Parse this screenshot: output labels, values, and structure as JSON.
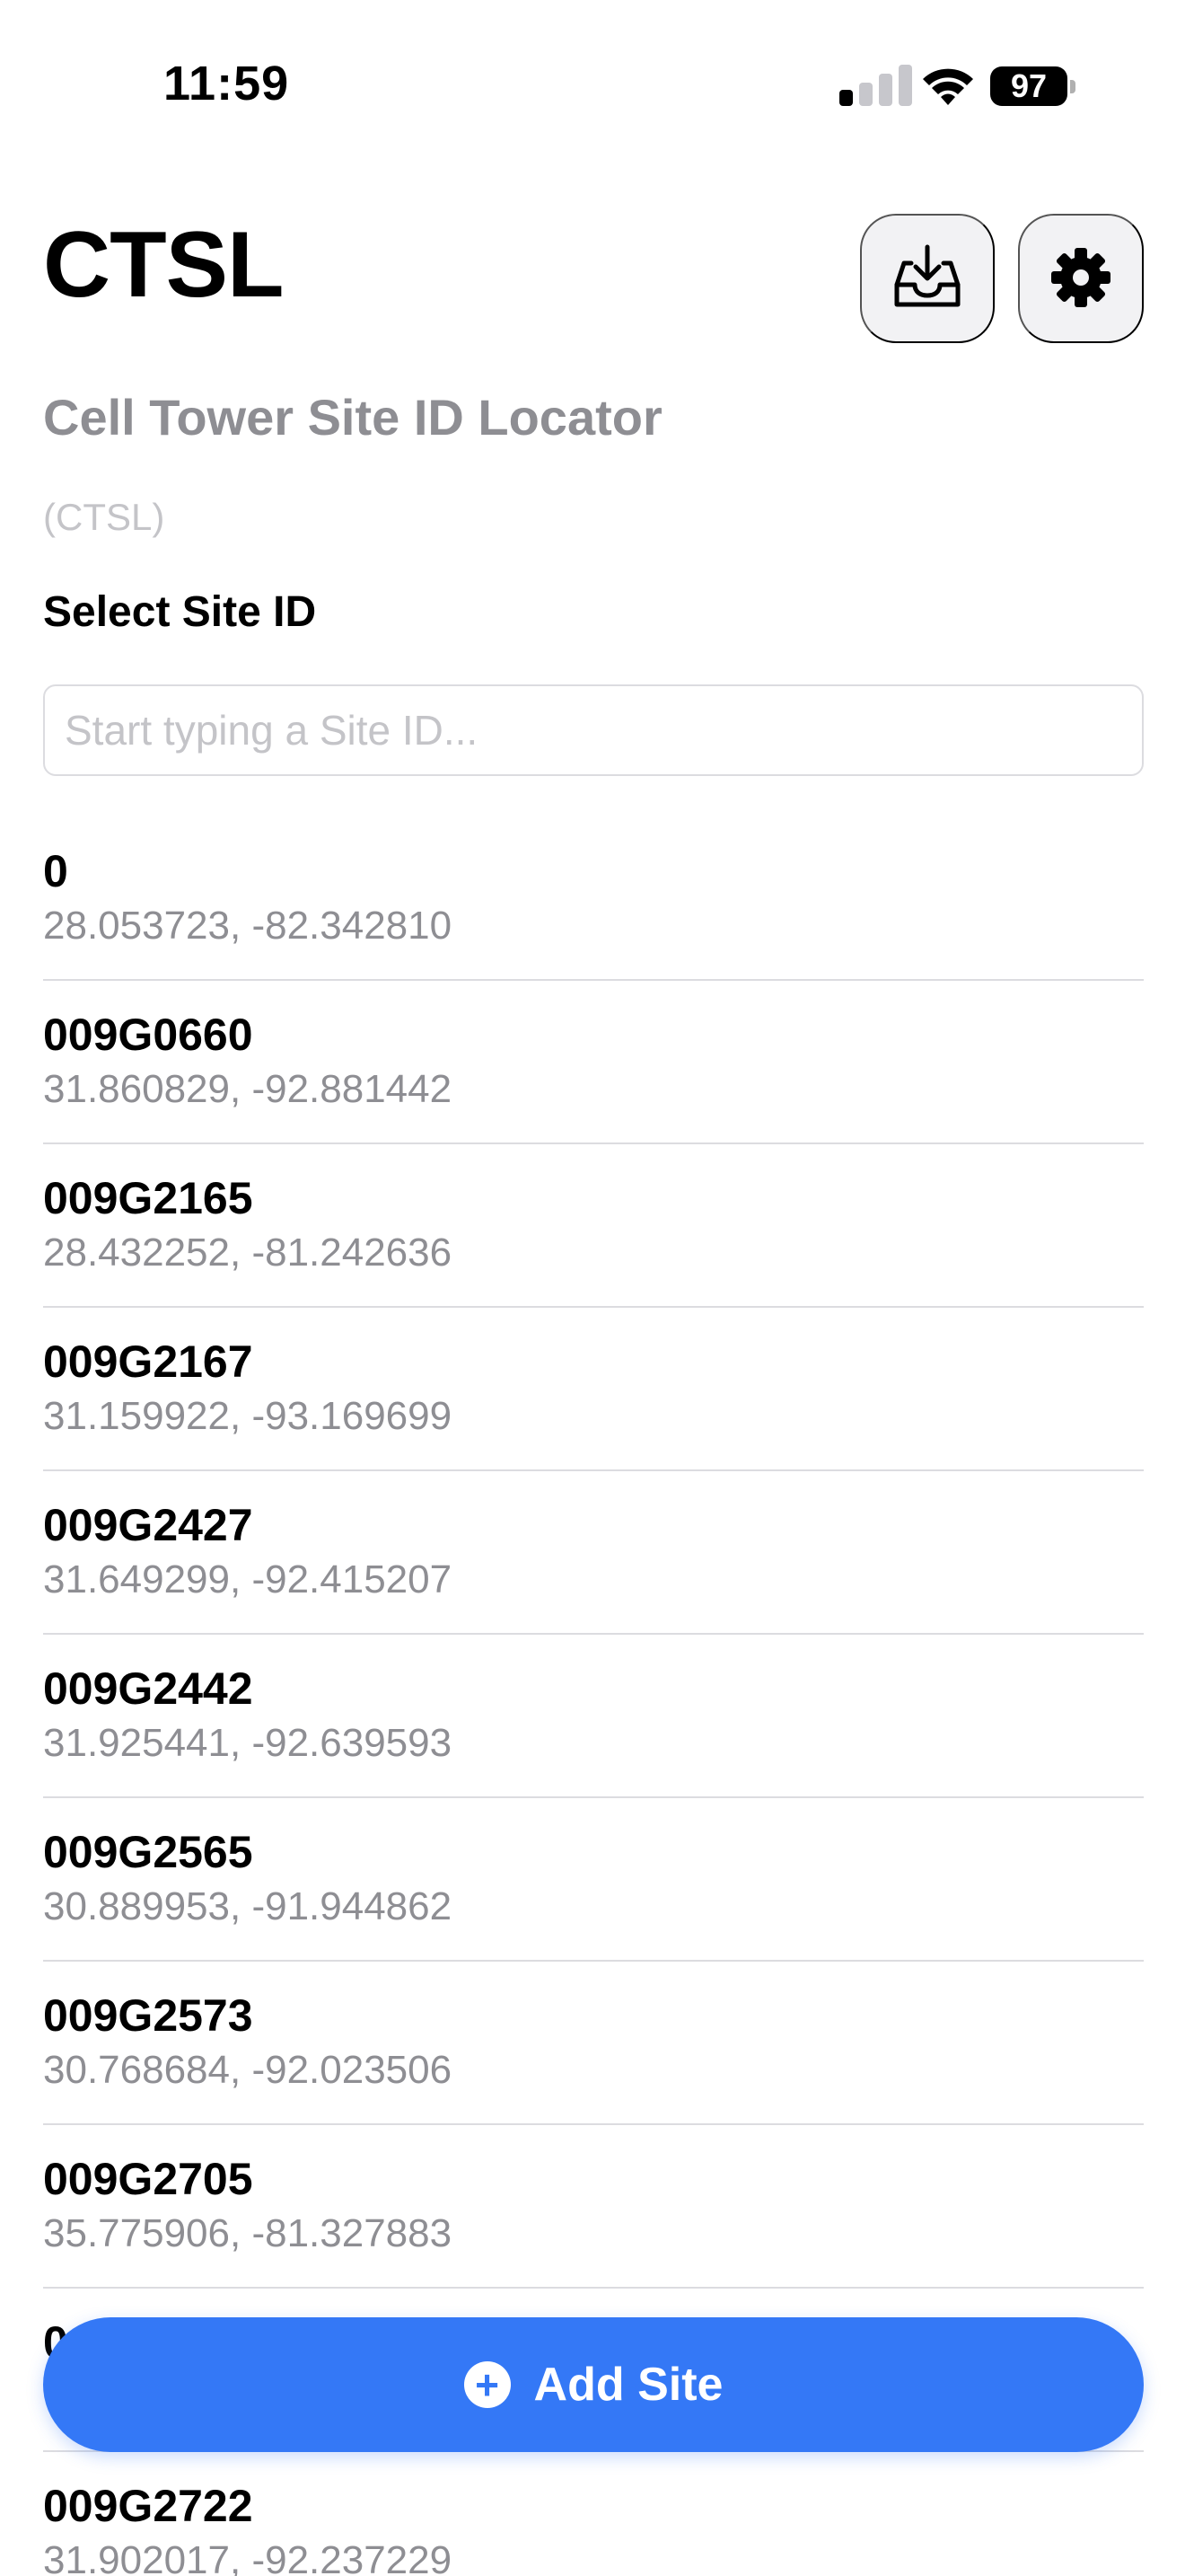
{
  "status_bar": {
    "time": "11:59",
    "battery": "97",
    "signal_bars_active": 1,
    "signal_bars_total": 4
  },
  "header": {
    "title": "CTSL",
    "import_icon": "tray-download-icon",
    "settings_icon": "gear-icon"
  },
  "subtitle": "Cell Tower Site ID Locator",
  "abbreviation": "(CTSL)",
  "search": {
    "label": "Select Site ID",
    "placeholder": "Start typing a Site ID...",
    "value": ""
  },
  "sites": [
    {
      "id": "0",
      "coords": "28.053723, -82.342810"
    },
    {
      "id": "009G0660",
      "coords": "31.860829, -92.881442"
    },
    {
      "id": "009G2165",
      "coords": "28.432252, -81.242636"
    },
    {
      "id": "009G2167",
      "coords": "31.159922, -93.169699"
    },
    {
      "id": "009G2427",
      "coords": "31.649299, -92.415207"
    },
    {
      "id": "009G2442",
      "coords": "31.925441, -92.639593"
    },
    {
      "id": "009G2565",
      "coords": "30.889953, -91.944862"
    },
    {
      "id": "009G2573",
      "coords": "30.768684, -92.023506"
    },
    {
      "id": "009G2705",
      "coords": "35.775906, -81.327883"
    },
    {
      "id": "0",
      "coords": ""
    },
    {
      "id": "009G2722",
      "coords": "31.902017, -92.237229"
    }
  ],
  "add_button": {
    "label": "Add Site",
    "icon": "plus-circle-icon"
  },
  "colors": {
    "accent": "#3478f6",
    "secondary_text": "#8e8e93",
    "separator": "#dcdce0"
  }
}
